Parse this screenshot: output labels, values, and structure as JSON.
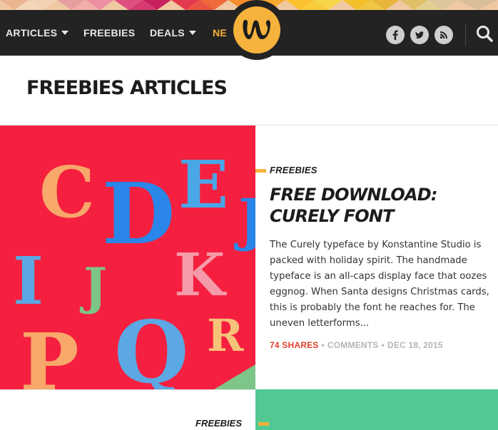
{
  "nav": {
    "items": [
      {
        "label": "ARTICLES",
        "has_dropdown": true
      },
      {
        "label": "FREEBIES",
        "has_dropdown": false
      },
      {
        "label": "DEALS",
        "has_dropdown": true
      },
      {
        "label": "NE",
        "has_dropdown": false
      }
    ],
    "logo_letter": "W",
    "social_icons": [
      "facebook-icon",
      "twitter-icon",
      "rss-icon"
    ],
    "search_icon": "search-icon"
  },
  "page": {
    "title": "FREEBIES ARTICLES"
  },
  "featured": {
    "category": "FREEBIES",
    "headline": "FREE DOWNLOAD: CURELY FONT",
    "excerpt": "The Curely typeface by Konstantine Studio is packed with holiday spirit. The handmade typeface is an all-caps display face that oozes eggnog. When Santa designs Christmas cards, this is probably the font he reaches for. The uneven letterforms...",
    "shares": "74 SHARES",
    "comments": "COMMENTS",
    "date": "DEC 18, 2015",
    "separator": "•",
    "image_letters": [
      "C",
      "D",
      "E",
      "J",
      "I",
      "K",
      "J",
      "P",
      "Q",
      "R"
    ]
  },
  "second": {
    "category": "FREEBIES"
  },
  "colors": {
    "nav_bg": "#232323",
    "accent_yellow": "#f6b23a",
    "shares_red": "#e2402c",
    "featured_image_bg": "#f5203f",
    "second_image_bg": "#52c992"
  }
}
